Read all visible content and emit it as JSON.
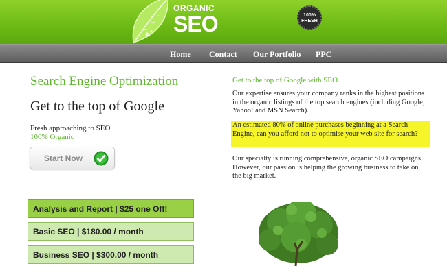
{
  "header": {
    "logo_top": "ORGANIC",
    "logo_main": "SEO",
    "badge_line1": "100%",
    "badge_line2": "FRESH"
  },
  "nav": {
    "items": [
      "Home",
      "Contact",
      "Our Portfolio",
      "PPC"
    ]
  },
  "left": {
    "heading": "Search Engine Optimization",
    "subheading": "Get to the top of Google",
    "tagline": "Fresh approaching to SEO",
    "tagline_accent": "100% Organic",
    "start_button": "Start Now",
    "plans": [
      "Analysis and Report | $25 one Off!",
      "Basic SEO | $180.00 / month",
      "Business SEO | $300.00 / month"
    ]
  },
  "right": {
    "title": "Get to the top of Google with SEO.",
    "paragraph1": "Our expertise ensures your company ranks in the highest positions in the organic listings of the top search engines (including Google, Yahoo! and MSN Search).",
    "highlight": "An estimated 80% of online purchases beginning at a Search Engine, can you afford not to optimise your web site for search?",
    "paragraph2": "Our specialty is running comprehensive, organic SEO campaigns. However, our passion is helping the growing business to take on the big market."
  },
  "colors": {
    "brand_green": "#5cb82a",
    "header_green": "#6fbb17",
    "nav_gray": "#6e6e6e",
    "highlight_yellow": "#f5f52a",
    "plan_green": "#cfeab0"
  },
  "icons": [
    "leaf-icon",
    "check-icon",
    "tree-image"
  ]
}
